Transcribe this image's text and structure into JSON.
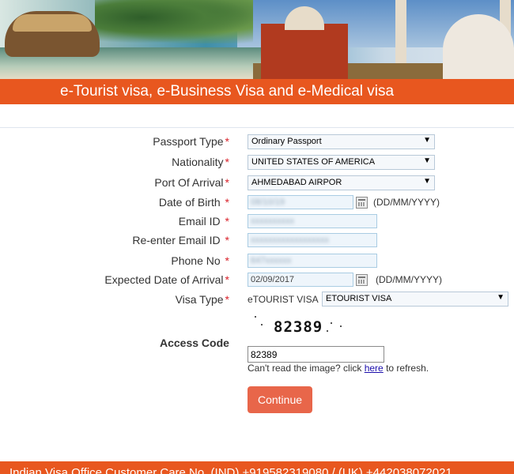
{
  "header": {
    "title": "e-Tourist visa, e-Business Visa and e-Medical visa"
  },
  "form": {
    "passport_type": {
      "label": "Passport Type",
      "value": "Ordinary Passport"
    },
    "nationality": {
      "label": "Nationality",
      "value": "UNITED STATES OF AMERICA"
    },
    "port_of_arrival": {
      "label": "Port Of Arrival",
      "value": "AHMEDABAD AIRPOR"
    },
    "date_of_birth": {
      "label": "Date of Birth",
      "value": "",
      "format": "(DD/MM/YYYY)"
    },
    "email": {
      "label": "Email ID",
      "value": ""
    },
    "reenter_email": {
      "label": "Re-enter Email ID",
      "value": ""
    },
    "phone": {
      "label": "Phone No",
      "value": ""
    },
    "expected_arrival": {
      "label": "Expected Date of Arrival",
      "value": "02/09/2017",
      "format": "(DD/MM/YYYY)"
    },
    "visa_type": {
      "label": "Visa Type",
      "prefix": "eTOURIST VISA",
      "value": "ETOURIST VISA"
    },
    "access_code": {
      "label": "Access Code",
      "captcha": "82389",
      "value": "82389"
    },
    "refresh": {
      "before": "Can't read the image? click ",
      "link": "here",
      "after": " to refresh."
    },
    "required_marker": "*",
    "continue_label": "Continue"
  },
  "footer": {
    "text": "Indian Visa Office Customer Care No. (IND) +919582319080 / (UK) +442038072021"
  },
  "colors": {
    "accent": "#e8571f",
    "button": "#e8664a",
    "required": "#d9212a"
  },
  "icons": {
    "dropdown": "▼",
    "calendar": "calendar-icon"
  }
}
